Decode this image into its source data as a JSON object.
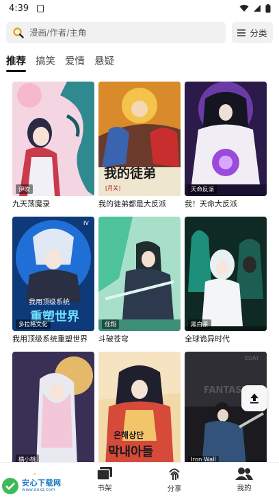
{
  "status_bar": {
    "time": "4:39"
  },
  "search": {
    "placeholder": "漫画/作者/主角"
  },
  "category_button": {
    "label": "分类",
    "icon": "menu-icon"
  },
  "tabs": [
    {
      "label": "推荐",
      "active": true
    },
    {
      "label": "搞笑",
      "active": false
    },
    {
      "label": "爱情",
      "active": false
    },
    {
      "label": "悬疑",
      "active": false
    }
  ],
  "comics": [
    {
      "title": "九天荡魔录",
      "author": "伊吹"
    },
    {
      "title": "我的徒弟都是大反派",
      "author": ""
    },
    {
      "title": "我！天命大反派",
      "author": "天命反派"
    },
    {
      "title": "我用顶级系统重塑世界",
      "author": "多拉格文化"
    },
    {
      "title": "斗破苍穹",
      "author": "任翔"
    },
    {
      "title": "全球诡异时代",
      "author": "黑白茶"
    },
    {
      "title": "",
      "author": "橘小桃"
    },
    {
      "title": "",
      "author": ""
    },
    {
      "title": "",
      "author": "Iron Wall"
    }
  ],
  "cover_art": {
    "c2_text": "我的徒弟",
    "c2_sub": "[月关]",
    "c4_text1": "我用顶级系统",
    "c4_text2": "重塑世界",
    "c4_corner": "IV",
    "c8_text1": "은해상단",
    "c8_text2": "막내아들",
    "c9_text": "FANTASY",
    "c9_corner": "EDAY"
  },
  "bottom_nav": [
    {
      "label": "",
      "icon": "home-icon"
    },
    {
      "label": "书架",
      "icon": "bookshelf-icon"
    },
    {
      "label": "分享",
      "icon": "fingerprint-icon"
    },
    {
      "label": "我的",
      "icon": "user-group-icon"
    }
  ],
  "watermark": {
    "brand": "安心下载网",
    "url": "www.anxz.com"
  }
}
